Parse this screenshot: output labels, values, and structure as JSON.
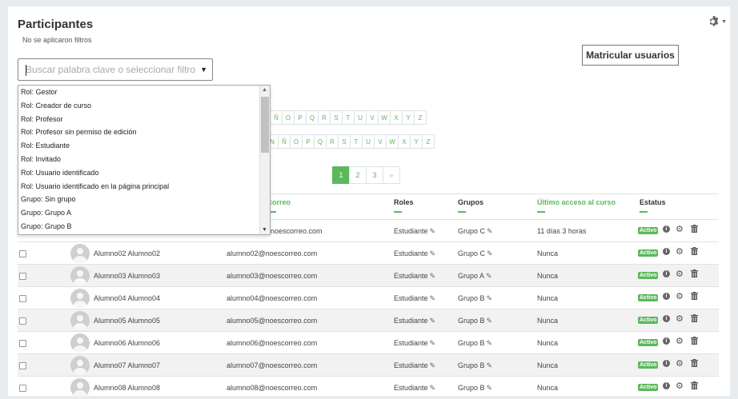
{
  "header": {
    "title": "Participantes",
    "subtitle": "No se aplicaron filtros",
    "enrol_button": "Matricular usuarios"
  },
  "search": {
    "placeholder": "Buscar palabra clave o seleccionar filtro"
  },
  "filter_options": [
    "Rol: Gestor",
    "Rol: Creador de curso",
    "Rol: Profesor",
    "Rol: Profesor sin permiso de edición",
    "Rol: Estudiante",
    "Rol: Invitado",
    "Rol: Usuario identificado",
    "Rol: Usuario identificado en la página principal",
    "Grupo: Sin grupo",
    "Grupo: Grupo A",
    "Grupo: Grupo B"
  ],
  "letters_row1": [
    "Ñ",
    "O",
    "P",
    "Q",
    "R",
    "S",
    "T",
    "U",
    "V",
    "W",
    "X",
    "Y",
    "Z"
  ],
  "letters_row2": [
    "N",
    "Ñ",
    "O",
    "P",
    "Q",
    "R",
    "S",
    "T",
    "U",
    "V",
    "W",
    "X",
    "Y",
    "Z"
  ],
  "pagination": {
    "pages": [
      "1",
      "2",
      "3"
    ],
    "next": "»"
  },
  "table": {
    "headers": {
      "email": "correo",
      "roles": "Roles",
      "groups": "Grupos",
      "last_access": "Último acceso al curso",
      "status": "Estatus"
    },
    "partial_row": {
      "email": "noescorreo.com",
      "role": "Estudiante",
      "group": "Grupo C",
      "last_access": "11 días 3 horas",
      "status": "Activo"
    },
    "rows": [
      {
        "name": "Alumno02 Alumno02",
        "email": "alumno02@noescorreo.com",
        "role": "Estudiante",
        "group": "Grupo C",
        "last_access": "Nunca",
        "status": "Activo"
      },
      {
        "name": "Alumno03 Alumno03",
        "email": "alumno03@noescorreo.com",
        "role": "Estudiante",
        "group": "Grupo A",
        "last_access": "Nunca",
        "status": "Activo"
      },
      {
        "name": "Alumno04 Alumno04",
        "email": "alumno04@noescorreo.com",
        "role": "Estudiante",
        "group": "Grupo B",
        "last_access": "Nunca",
        "status": "Activo"
      },
      {
        "name": "Alumno05 Alumno05",
        "email": "alumno05@noescorreo.com",
        "role": "Estudiante",
        "group": "Grupo B",
        "last_access": "Nunca",
        "status": "Activo"
      },
      {
        "name": "Alumno06 Alumno06",
        "email": "alumno06@noescorreo.com",
        "role": "Estudiante",
        "group": "Grupo B",
        "last_access": "Nunca",
        "status": "Activo"
      },
      {
        "name": "Alumno07 Alumno07",
        "email": "alumno07@noescorreo.com",
        "role": "Estudiante",
        "group": "Grupo B",
        "last_access": "Nunca",
        "status": "Activo"
      },
      {
        "name": "Alumno08 Alumno08",
        "email": "alumno08@noescorreo.com",
        "role": "Estudiante",
        "group": "Grupo B",
        "last_access": "Nunca",
        "status": "Activo"
      }
    ]
  },
  "colors": {
    "accent": "#5cb85c",
    "page_bg": "#e9ecef",
    "row_alt": "#f2f2f2"
  },
  "icons": [
    "gear-icon",
    "chevron-down-icon",
    "pencil-icon",
    "info-icon",
    "cog-icon",
    "trash-icon",
    "avatar"
  ]
}
